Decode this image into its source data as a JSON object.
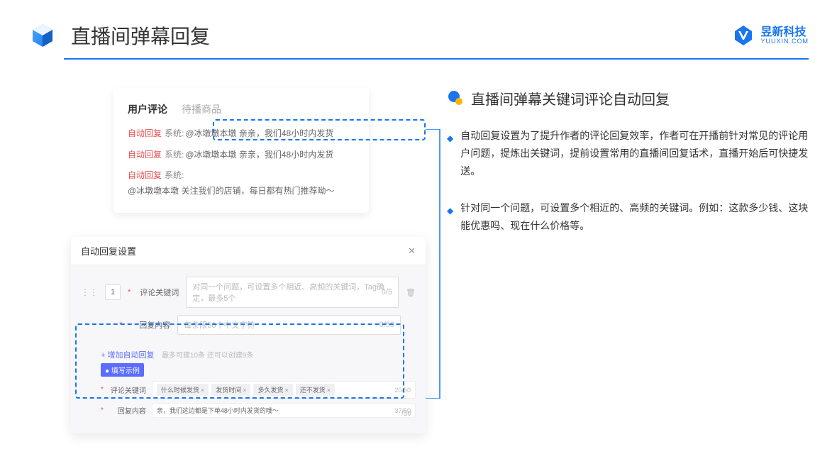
{
  "header": {
    "title": "直播间弹幕回复",
    "logo_cn": "昱新科技",
    "logo_en": "YUUXIN.COM"
  },
  "tabs": {
    "active": "用户评论",
    "inactive": "待播商品"
  },
  "comments": {
    "c1_tag": "自动回复",
    "c1_sys": "系统:",
    "c1_text": "@冰墩墩本墩 亲亲，我们48小时内发货",
    "c2_tag": "自动回复",
    "c2_sys": "系统:",
    "c2_text": "@冰墩墩本墩 亲亲，我们48小时内发货",
    "c3_tag": "自动回复",
    "c3_sys": "系统:",
    "c3_text": "@冰墩墩本墩 关注我们的店铺，每日都有热门推荐呦～"
  },
  "settings": {
    "title": "自动回复设置",
    "num": "1",
    "label_keyword": "评论关键词",
    "placeholder_keyword": "对同一个问题，可设置多个相近、高频的关键词，Tag确定，最多5个",
    "count_keyword": "0/5",
    "label_content": "回复内容",
    "placeholder_content": "每条限50个中文字符",
    "count_content": "0/50",
    "add_link": "+ 增加自动回复",
    "add_hint": "最多可建10条 还可以创建9条",
    "example_badge": "● 填写示例",
    "example_label_keyword": "评论关键词",
    "example_tags": [
      "什么时候发货",
      "发货时间",
      "多久发货",
      "还不发货"
    ],
    "example_count_keyword": "20/50",
    "example_label_content": "回复内容",
    "example_content_text": "亲，我们这边都是下单48小时内发货的哦～",
    "example_count_content": "37/50",
    "extra_count": "/50"
  },
  "right": {
    "section_title": "直播间弹幕关键词评论自动回复",
    "bullet1": "自动回复设置为了提升作者的评论回复效率，作者可在开播前针对常见的评论用户问题，提炼出关键词，提前设置常用的直播间回复话术，直播开始后可快捷发送。",
    "bullet2": "针对同一个问题，可设置多个相近的、高频的关键词。例如：这款多少钱、这块能优惠吗、现在什么价格等。"
  }
}
